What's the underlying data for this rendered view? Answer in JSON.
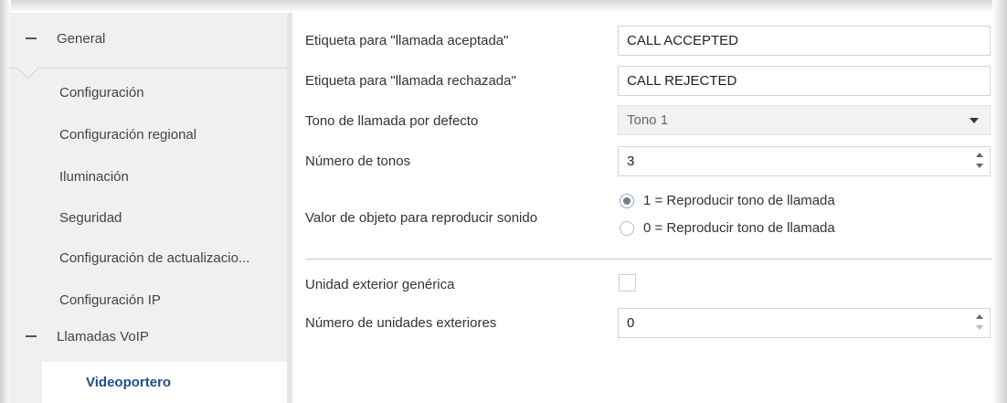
{
  "sidebar": {
    "group_general": "General",
    "items": [
      {
        "label": "Configuración"
      },
      {
        "label": "Configuración regional"
      },
      {
        "label": "Iluminación"
      },
      {
        "label": "Seguridad"
      },
      {
        "label": "Configuración de actualizacio..."
      },
      {
        "label": "Configuración IP"
      }
    ],
    "group_voip": "Llamadas VoIP",
    "active_item": "Videoportero"
  },
  "form": {
    "accepted_label": "Etiqueta para \"llamada aceptada\"",
    "accepted_value": "CALL ACCEPTED",
    "rejected_label": "Etiqueta para \"llamada rechazada\"",
    "rejected_value": "CALL REJECTED",
    "ringtone_label": "Tono de llamada por defecto",
    "ringtone_value": "Tono 1",
    "num_tones_label": "Número de tonos",
    "num_tones_value": "3",
    "sound_object_label": "Valor de objeto para reproducir sonido",
    "sound_options": [
      {
        "label": "1 = Reproducir tono de llamada",
        "selected": true
      },
      {
        "label": "0 = Reproducir tono de llamada",
        "selected": false
      }
    ],
    "generic_outdoor_label": "Unidad exterior genérica",
    "generic_outdoor_checked": false,
    "num_outdoor_label": "Número de unidades exteriores",
    "num_outdoor_value": "0"
  },
  "colors": {
    "sidebar_bg": "#f0f0f0",
    "active_text": "#1f4e8c"
  }
}
